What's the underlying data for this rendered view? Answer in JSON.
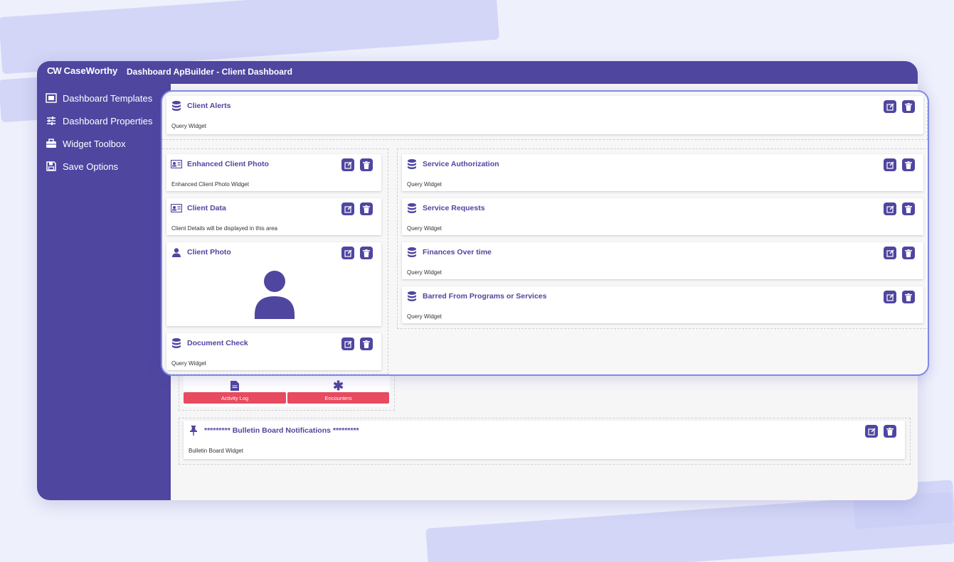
{
  "app": {
    "logo_mark": "CW",
    "logo_text": "CaseWorthy",
    "title": "Dashboard ApBuilder - Client Dashboard"
  },
  "sidebar": {
    "items": [
      {
        "label": "Dashboard Templates",
        "icon": "template-icon"
      },
      {
        "label": "Dashboard Properties",
        "icon": "sliders-icon"
      },
      {
        "label": "Widget Toolbox",
        "icon": "toolbox-icon"
      },
      {
        "label": "Save Options",
        "icon": "save-icon"
      }
    ]
  },
  "overlay": {
    "client_alerts": {
      "title": "Client Alerts",
      "subtitle": "Query Widget",
      "icon": "database-icon"
    },
    "enhanced_client_photo": {
      "title": "Enhanced Client Photo",
      "subtitle": "Enhanced Client Photo Widget",
      "icon": "id-card-icon"
    },
    "client_data": {
      "title": "Client Data",
      "subtitle": "Client Details will be displayed in this area",
      "icon": "id-card-icon"
    },
    "client_photo": {
      "title": "Client Photo",
      "icon": "user-icon"
    },
    "document_check": {
      "title": "Document Check",
      "subtitle": "Query Widget",
      "icon": "database-icon"
    },
    "service_authorization": {
      "title": "Service Authorization",
      "subtitle": "Query Widget",
      "icon": "database-icon"
    },
    "service_requests": {
      "title": "Service Requests",
      "subtitle": "Query Widget",
      "icon": "database-icon"
    },
    "finances_over_time": {
      "title": "Finances Over time",
      "subtitle": "Query Widget",
      "icon": "database-icon"
    },
    "barred": {
      "title": "Barred From Programs or Services",
      "subtitle": "Query Widget",
      "icon": "database-icon"
    }
  },
  "background": {
    "activity_log_label": "Activity Log",
    "encounters_label": "Encounters",
    "bulletin": {
      "title": "********* Bulletin Board Notifications *********",
      "subtitle": "Bulletin Board Widget",
      "icon": "pin-icon"
    }
  },
  "colors": {
    "brand": "#4f46a0",
    "accent_red": "#e84a5f",
    "overlay_border": "#7f89e8"
  }
}
